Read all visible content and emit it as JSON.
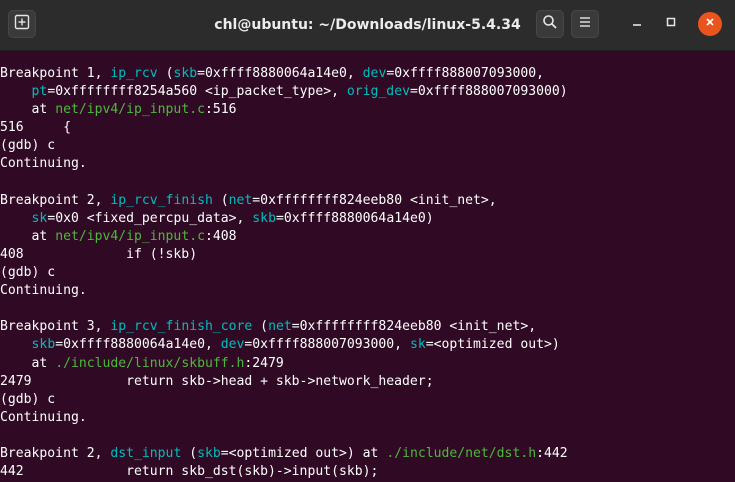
{
  "titlebar": {
    "title": "chl@ubuntu: ~/Downloads/linux-5.4.34",
    "new_tab_icon": "new-tab-icon",
    "search_icon": "search-icon",
    "menu_icon": "hamburger-menu-icon",
    "minimize_icon": "minimize-icon",
    "maximize_icon": "maximize-icon",
    "close_icon": "close-icon"
  },
  "colors": {
    "background": "#300a24",
    "titlebar": "#2c2c2c",
    "function_name": "#00bdbd",
    "file_path": "#4db83c",
    "close_button": "#e9541f"
  },
  "terminal": {
    "lines": [
      {
        "segments": [
          {
            "t": "Breakpoint 1, "
          },
          {
            "t": "ip_rcv",
            "c": "fn"
          },
          {
            "t": " ("
          },
          {
            "t": "skb",
            "c": "arg"
          },
          {
            "t": "=0xffff8880064a14e0, "
          },
          {
            "t": "dev",
            "c": "arg"
          },
          {
            "t": "=0xffff888007093000,"
          }
        ]
      },
      {
        "segments": [
          {
            "t": "    "
          },
          {
            "t": "pt",
            "c": "arg"
          },
          {
            "t": "=0xffffffff8254a560 <ip_packet_type>, "
          },
          {
            "t": "orig_dev",
            "c": "arg"
          },
          {
            "t": "=0xffff888007093000)"
          }
        ]
      },
      {
        "segments": [
          {
            "t": "    at "
          },
          {
            "t": "net/ipv4/ip_input.c",
            "c": "file"
          },
          {
            "t": ":516"
          }
        ]
      },
      {
        "segments": [
          {
            "t": "516\t{"
          }
        ]
      },
      {
        "segments": [
          {
            "t": "(gdb) c"
          }
        ]
      },
      {
        "segments": [
          {
            "t": "Continuing."
          }
        ]
      },
      {
        "segments": [
          {
            "t": ""
          }
        ]
      },
      {
        "segments": [
          {
            "t": "Breakpoint 2, "
          },
          {
            "t": "ip_rcv_finish",
            "c": "fn"
          },
          {
            "t": " ("
          },
          {
            "t": "net",
            "c": "arg"
          },
          {
            "t": "=0xffffffff824eeb80 <init_net>,"
          }
        ]
      },
      {
        "segments": [
          {
            "t": "    "
          },
          {
            "t": "sk",
            "c": "arg"
          },
          {
            "t": "=0x0 <fixed_percpu_data>, "
          },
          {
            "t": "skb",
            "c": "arg"
          },
          {
            "t": "=0xffff8880064a14e0)"
          }
        ]
      },
      {
        "segments": [
          {
            "t": "    at "
          },
          {
            "t": "net/ipv4/ip_input.c",
            "c": "file"
          },
          {
            "t": ":408"
          }
        ]
      },
      {
        "segments": [
          {
            "t": "408\t\tif (!skb)"
          }
        ]
      },
      {
        "segments": [
          {
            "t": "(gdb) c"
          }
        ]
      },
      {
        "segments": [
          {
            "t": "Continuing."
          }
        ]
      },
      {
        "segments": [
          {
            "t": ""
          }
        ]
      },
      {
        "segments": [
          {
            "t": "Breakpoint 3, "
          },
          {
            "t": "ip_rcv_finish_core",
            "c": "fn"
          },
          {
            "t": " ("
          },
          {
            "t": "net",
            "c": "arg"
          },
          {
            "t": "=0xffffffff824eeb80 <init_net>,"
          }
        ]
      },
      {
        "segments": [
          {
            "t": "    "
          },
          {
            "t": "skb",
            "c": "arg"
          },
          {
            "t": "=0xffff8880064a14e0, "
          },
          {
            "t": "dev",
            "c": "arg"
          },
          {
            "t": "=0xffff888007093000, "
          },
          {
            "t": "sk",
            "c": "arg"
          },
          {
            "t": "=<optimized out>)"
          }
        ]
      },
      {
        "segments": [
          {
            "t": "    at "
          },
          {
            "t": "./include/linux/skbuff.h",
            "c": "file"
          },
          {
            "t": ":2479"
          }
        ]
      },
      {
        "segments": [
          {
            "t": "2479\t\treturn skb->head + skb->network_header;"
          }
        ]
      },
      {
        "segments": [
          {
            "t": "(gdb) c"
          }
        ]
      },
      {
        "segments": [
          {
            "t": "Continuing."
          }
        ]
      },
      {
        "segments": [
          {
            "t": ""
          }
        ]
      },
      {
        "segments": [
          {
            "t": "Breakpoint 2, "
          },
          {
            "t": "dst_input",
            "c": "fn"
          },
          {
            "t": " ("
          },
          {
            "t": "skb",
            "c": "arg"
          },
          {
            "t": "=<optimized out>) at "
          },
          {
            "t": "./include/net/dst.h",
            "c": "file"
          },
          {
            "t": ":442"
          }
        ]
      },
      {
        "segments": [
          {
            "t": "442\t\treturn skb_dst(skb)->input(skb);"
          }
        ]
      }
    ]
  }
}
